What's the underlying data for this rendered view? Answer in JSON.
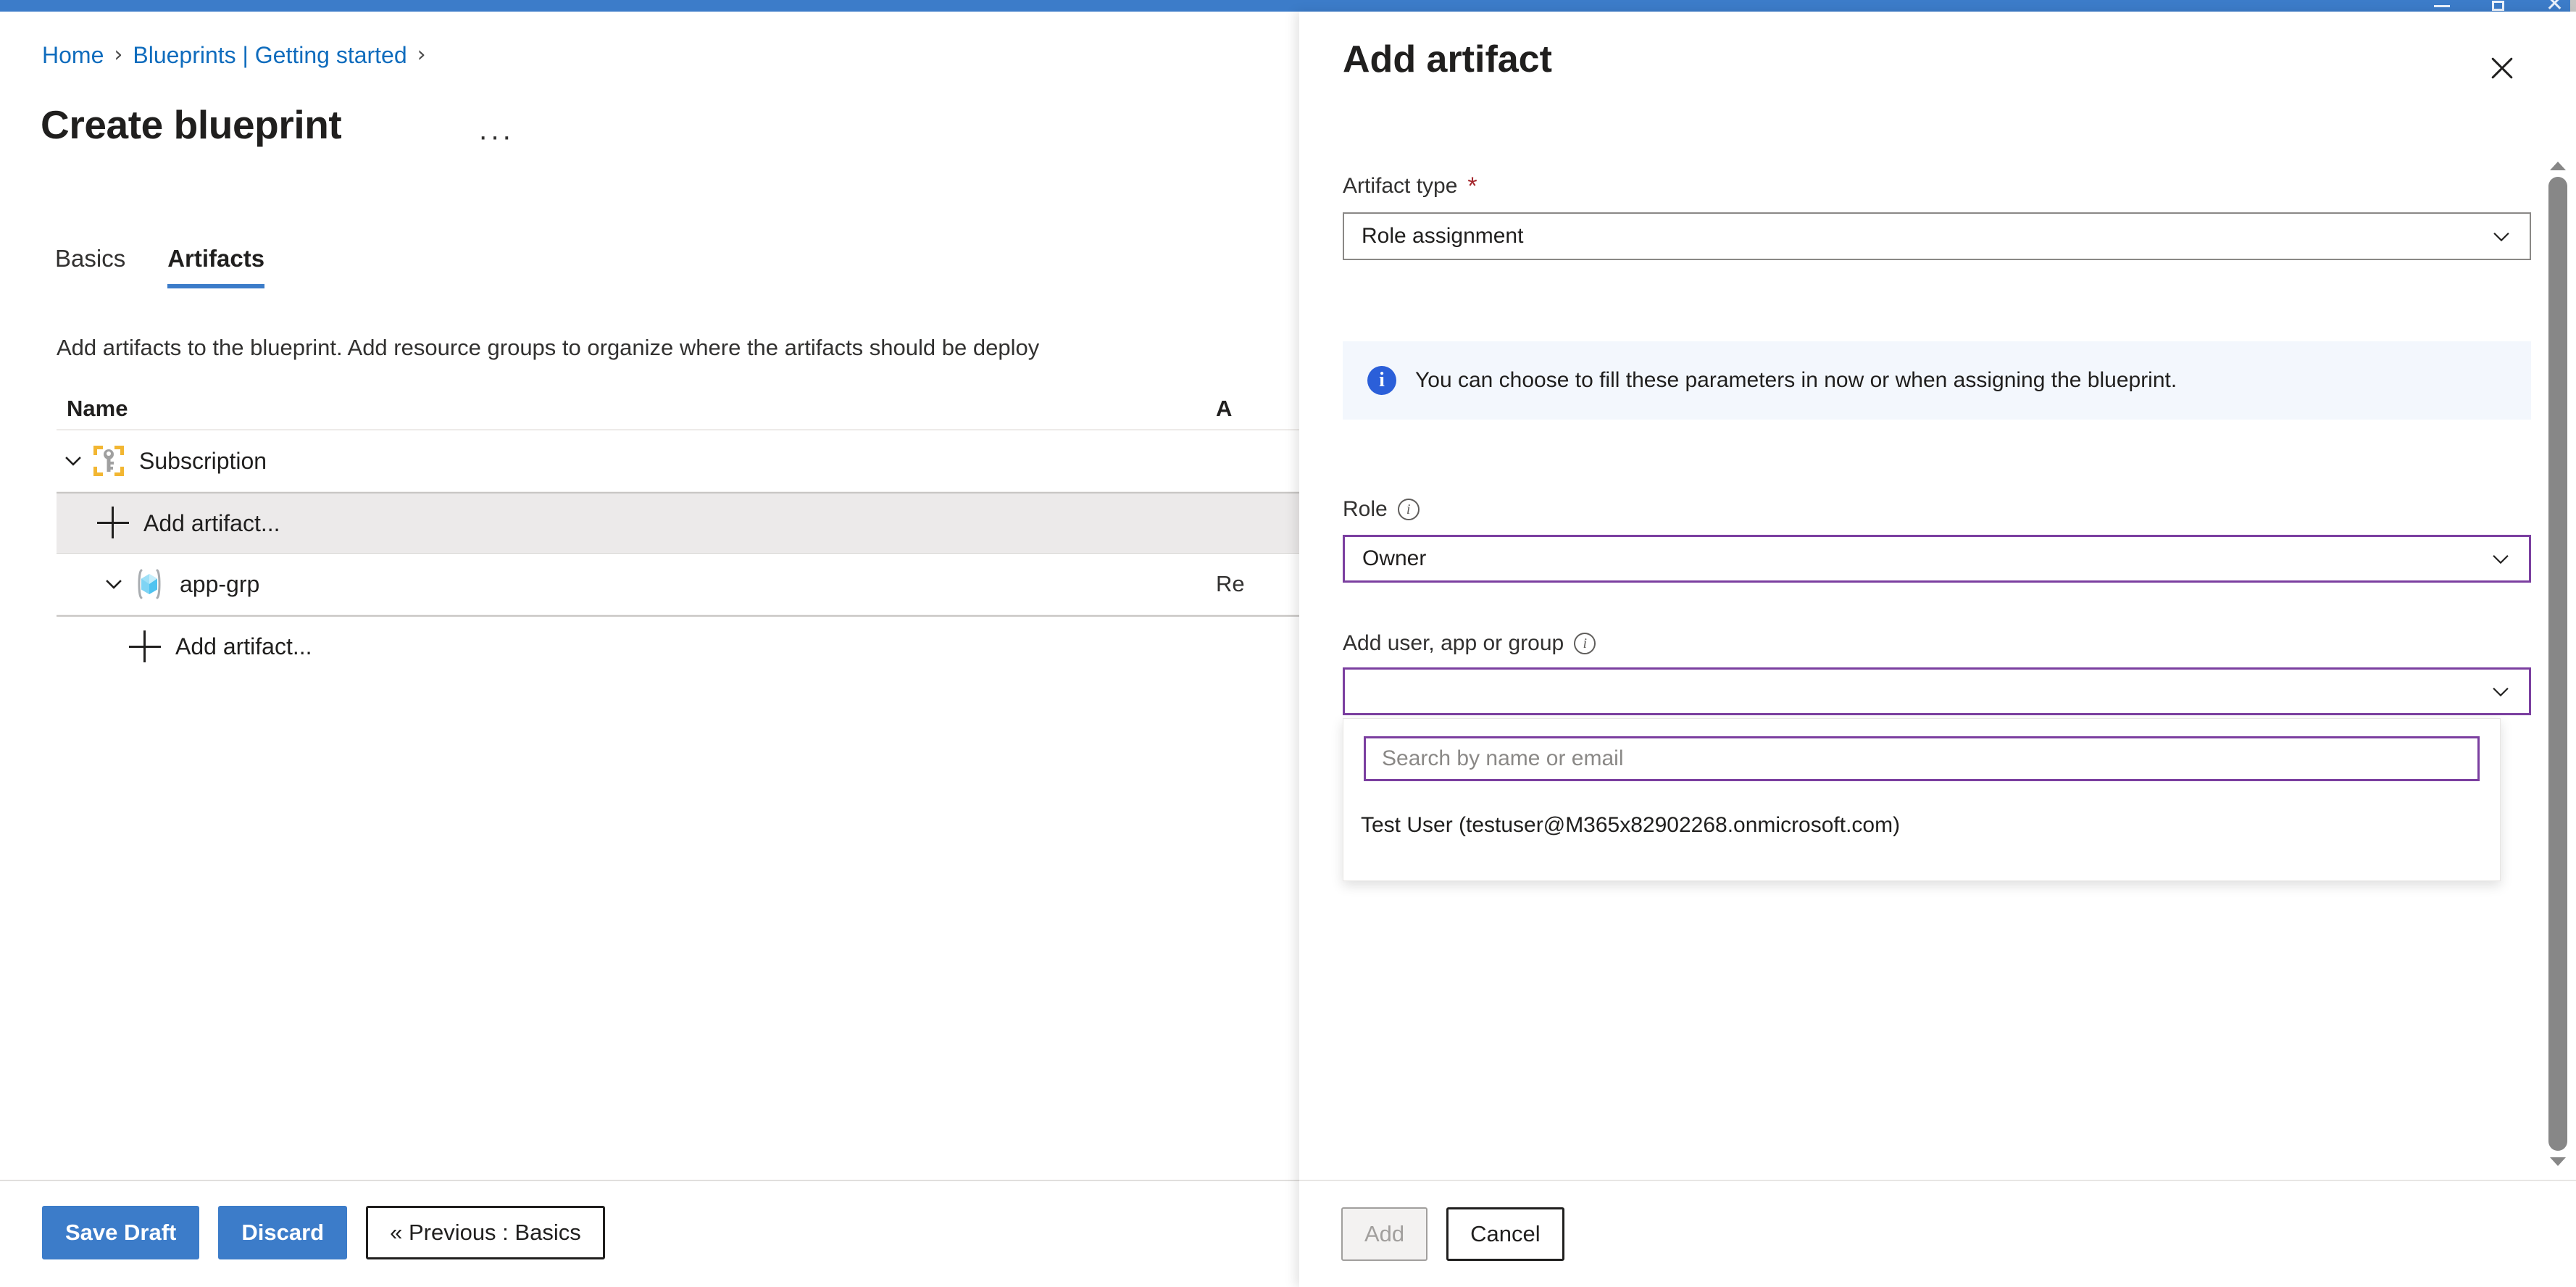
{
  "window": {
    "titlebar_color": "#3c7cc9",
    "controls": [
      "minimize-icon",
      "maximize-icon",
      "close-icon"
    ]
  },
  "breadcrumb": {
    "items": [
      {
        "label": "Home",
        "link": true
      },
      {
        "label": "Blueprints | Getting started",
        "link": true
      }
    ],
    "separator": "›"
  },
  "page": {
    "title": "Create blueprint",
    "more_ellipsis": "···"
  },
  "tabs": [
    {
      "label": "Basics",
      "active": false
    },
    {
      "label": "Artifacts",
      "active": true
    }
  ],
  "main": {
    "description": "Add artifacts to the blueprint. Add resource groups to organize where the artifacts should be deploy",
    "table": {
      "columns": [
        "Name",
        "A"
      ],
      "rows": [
        {
          "name": "Subscription",
          "icon": "subscription-key-icon",
          "indent": 0,
          "expanded": true,
          "artifact_type": ""
        },
        {
          "name": "Add artifact...",
          "icon": "plus-icon",
          "indent": 1,
          "selected": true,
          "artifact_type": ""
        },
        {
          "name": "app-grp",
          "icon": "resource-group-icon",
          "indent": 1,
          "expanded": true,
          "artifact_type": "Re"
        },
        {
          "name": "Add artifact...",
          "icon": "plus-icon",
          "indent": 2,
          "artifact_type": ""
        }
      ]
    }
  },
  "footer": {
    "save_draft": "Save Draft",
    "discard": "Discard",
    "previous": "« Previous : Basics"
  },
  "panel": {
    "title": "Add artifact",
    "close_label": "✕",
    "artifact_type": {
      "label": "Artifact type",
      "required_marker": "*",
      "value": "Role assignment"
    },
    "banner": {
      "icon": "info-icon",
      "text": "You can choose to fill these parameters in now or when assigning the blueprint.",
      "background": "#f3f7fd"
    },
    "role": {
      "label": "Role",
      "info_icon": "info-icon",
      "value": "Owner"
    },
    "principal": {
      "label": "Add user, app or group",
      "info_icon": "info-icon",
      "value": "",
      "flyout": {
        "search_placeholder": "Search by name or email",
        "options": [
          "Test User (testuser@M365x82902268.onmicrosoft.com)"
        ]
      }
    },
    "footer": {
      "add": "Add",
      "cancel": "Cancel"
    },
    "focus_color": "#7b3fa0"
  }
}
